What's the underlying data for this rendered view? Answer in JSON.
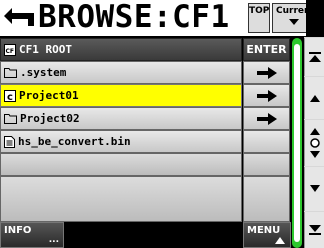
{
  "header": {
    "title": "BROWSE:CF1",
    "top_label": "TOP",
    "current_label": "Current"
  },
  "list": {
    "header_row": {
      "name": "CF1 ROOT",
      "action": "ENTER",
      "icon": "cf-card-icon"
    },
    "items": [
      {
        "name": ".system",
        "icon": "folder-icon",
        "action": "arrow-right-icon",
        "selected": false
      },
      {
        "name": "Project01",
        "icon": "project-icon",
        "action": "arrow-right-icon",
        "selected": true
      },
      {
        "name": "Project02",
        "icon": "folder-icon",
        "action": "arrow-right-icon",
        "selected": false
      },
      {
        "name": "hs_be_convert.bin",
        "icon": "file-icon",
        "action": "",
        "selected": false
      }
    ]
  },
  "footer": {
    "info_label": "INFO",
    "info_dots": "...",
    "menu_label": "MENU"
  },
  "colors": {
    "selected": "#ffff00",
    "scrollbar": "#2ec82e",
    "header": "#3f3f3f"
  }
}
